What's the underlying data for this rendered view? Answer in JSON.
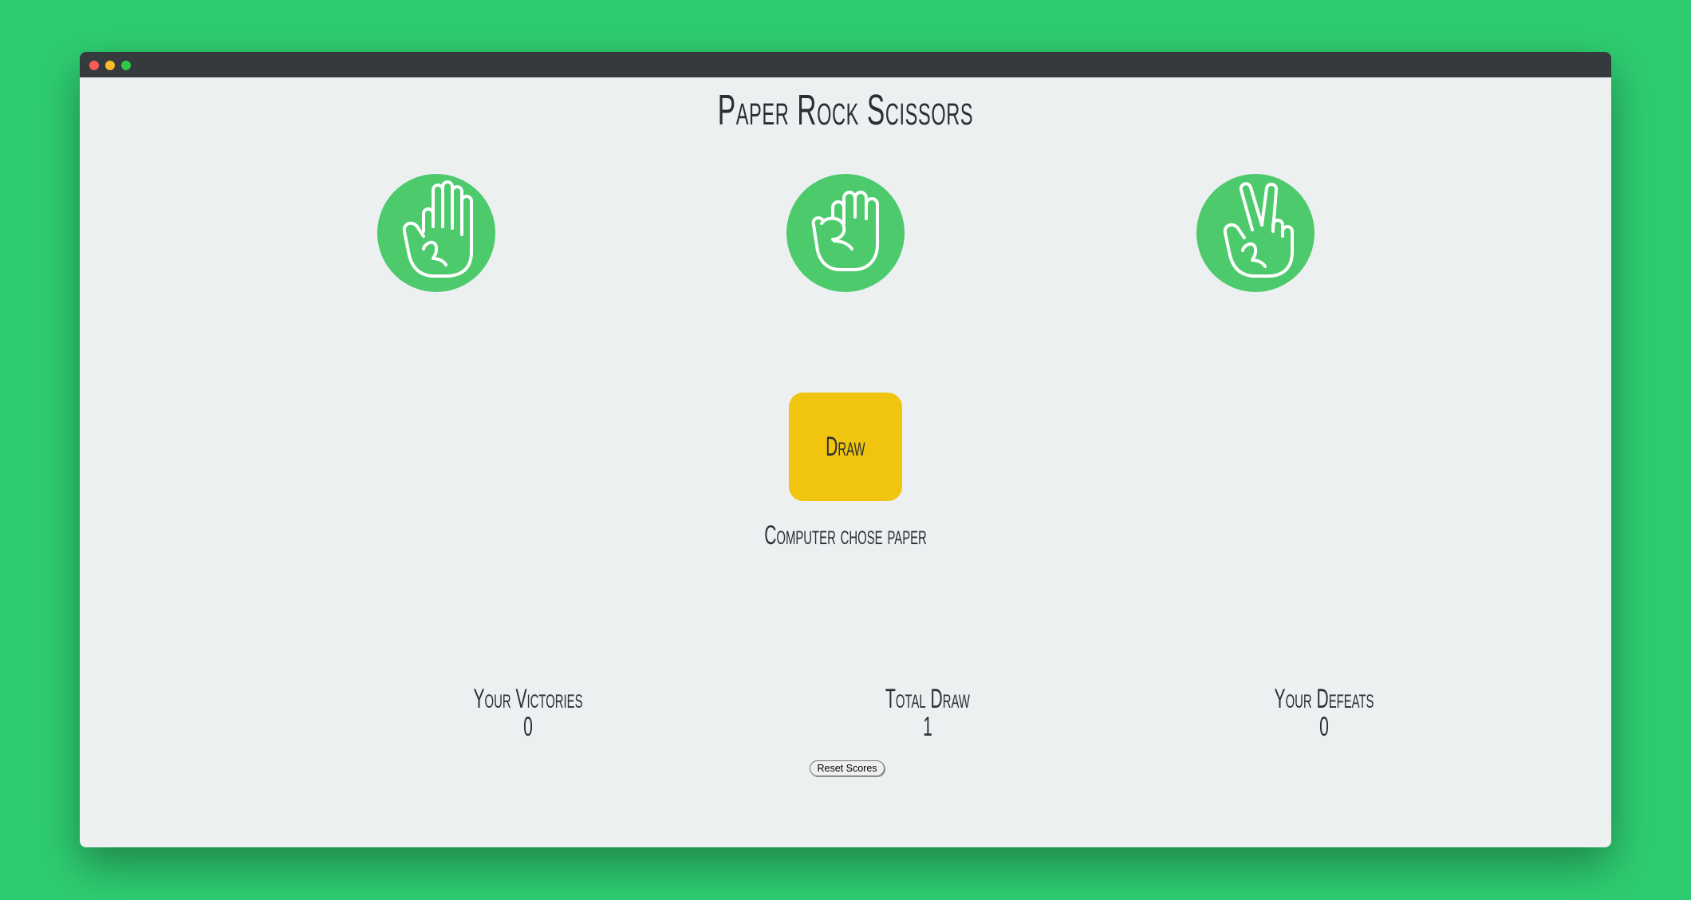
{
  "app": {
    "title": "Paper Rock Scissors"
  },
  "choices": [
    {
      "id": "paper",
      "icon": "paper-hand-icon"
    },
    {
      "id": "rock",
      "icon": "rock-fist-icon"
    },
    {
      "id": "scissors",
      "icon": "scissors-hand-icon"
    }
  ],
  "result": {
    "label": "Draw",
    "message": "Computer chose paper"
  },
  "scores": {
    "victories_label": "Your Victories",
    "victories_value": "0",
    "draws_label": "Total Draw",
    "draws_value": "1",
    "defeats_label": "Your Defeats",
    "defeats_value": "0"
  },
  "reset": {
    "label": "Reset Scores"
  },
  "colors": {
    "background": "#2ecc71",
    "window": "#ecf0f1",
    "choice_circle": "#4cca6c",
    "result_box": "#f1c40f",
    "titlebar": "#353a3d"
  }
}
